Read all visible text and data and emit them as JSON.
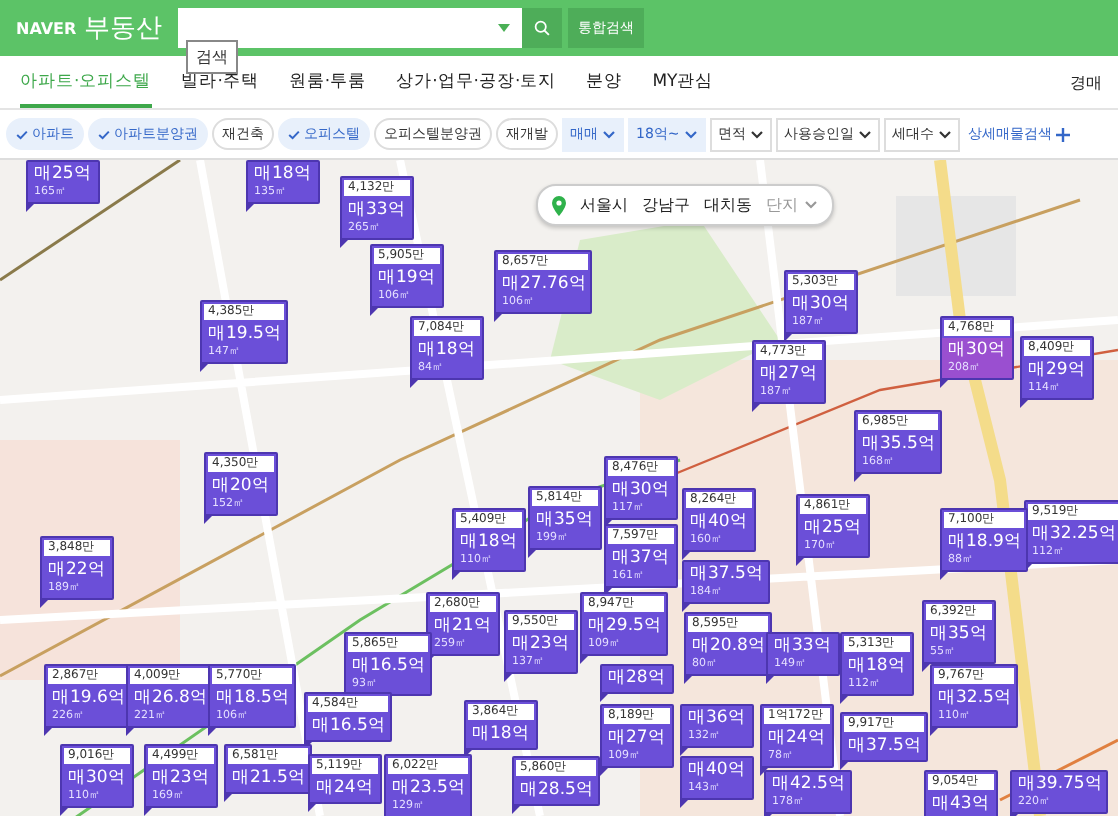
{
  "header": {
    "logo": "NAVER",
    "title": "부동산",
    "search_button_tooltip": "검색",
    "integrated_search": "통합검색"
  },
  "tabs": [
    {
      "label": "아파트·오피스텔",
      "selected": true
    },
    {
      "label": "빌라·주택",
      "selected": false
    },
    {
      "label": "원룸·투룸",
      "selected": false
    },
    {
      "label": "상가·업무·공장·토지",
      "selected": false
    },
    {
      "label": "분양",
      "selected": false
    },
    {
      "label": "MY관심",
      "selected": false
    }
  ],
  "auction_link": "경매",
  "filters": [
    {
      "kind": "chip",
      "label": "아파트",
      "checked": true
    },
    {
      "kind": "chip",
      "label": "아파트분양권",
      "checked": true
    },
    {
      "kind": "chip",
      "label": "재건축",
      "checked": false
    },
    {
      "kind": "chip",
      "label": "오피스텔",
      "checked": true
    },
    {
      "kind": "chip",
      "label": "오피스텔분양권",
      "checked": false
    },
    {
      "kind": "chip",
      "label": "재개발",
      "checked": false
    },
    {
      "kind": "dropdown",
      "label": "매매",
      "checked": true
    },
    {
      "kind": "dropdown",
      "label": "18억~",
      "checked": true
    },
    {
      "kind": "dropdown",
      "label": "면적",
      "checked": false
    },
    {
      "kind": "dropdown",
      "label": "사용승인일",
      "checked": false
    },
    {
      "kind": "dropdown",
      "label": "세대수",
      "checked": false
    }
  ],
  "detail_search": "상세매물검색",
  "breadcrumb": [
    {
      "label": "서울시",
      "disabled": false
    },
    {
      "label": "강남구",
      "disabled": false
    },
    {
      "label": "대치동",
      "disabled": false
    },
    {
      "label": "단지",
      "disabled": true
    }
  ],
  "markers": [
    {
      "price": "매25억",
      "area": "165㎡",
      "kind": "normal"
    },
    {
      "price": "매18억",
      "area": "135㎡",
      "kind": "normal"
    },
    {
      "unit_price": "4,132만",
      "price": "매33억",
      "area": "265㎡",
      "kind": "normal"
    },
    {
      "unit_price": "5,905만",
      "price": "매19억",
      "area": "106㎡",
      "kind": "normal"
    },
    {
      "unit_price": "8,657만",
      "price": "매27.76억",
      "area": "106㎡",
      "kind": "normal"
    },
    {
      "unit_price": "5,303만",
      "price": "매30억",
      "area": "187㎡",
      "kind": "normal"
    },
    {
      "unit_price": "4,385만",
      "price": "매19.5억",
      "area": "147㎡",
      "kind": "normal"
    },
    {
      "unit_price": "7,084만",
      "price": "매18억",
      "area": "84㎡",
      "kind": "normal"
    },
    {
      "unit_price": "4,768만",
      "price": "매30억",
      "area": "208㎡",
      "kind": "highlight"
    },
    {
      "unit_price": "4,773만",
      "price": "매27억",
      "area": "187㎡",
      "kind": "normal"
    },
    {
      "unit_price": "8,409만",
      "price": "매29억",
      "area": "114㎡",
      "kind": "normal"
    },
    {
      "unit_price": "6,985만",
      "price": "매35.5억",
      "area": "168㎡",
      "kind": "normal"
    },
    {
      "unit_price": "4,350만",
      "price": "매20억",
      "area": "152㎡",
      "kind": "normal"
    },
    {
      "unit_price": "8,476만",
      "price": "매30억",
      "area": "117㎡",
      "kind": "normal"
    },
    {
      "unit_price": "5,814만",
      "price": "매35억",
      "area": "199㎡",
      "kind": "normal"
    },
    {
      "unit_price": "8,264만",
      "price": "매40억",
      "area": "160㎡",
      "kind": "normal"
    },
    {
      "unit_price": "4,861만",
      "price": "매25억",
      "area": "170㎡",
      "kind": "normal"
    },
    {
      "unit_price": "9,519만",
      "price": "매32.25억",
      "area": "112㎡",
      "kind": "normal"
    },
    {
      "unit_price": "5,409만",
      "price": "매18억",
      "area": "110㎡",
      "kind": "normal"
    },
    {
      "unit_price": "7,100만",
      "price": "매18.9억",
      "area": "88㎡",
      "kind": "normal"
    },
    {
      "unit_price": "7,597만",
      "price": "매37억",
      "area": "161㎡",
      "kind": "normal"
    },
    {
      "unit_price": "3,848만",
      "price": "매22억",
      "area": "189㎡",
      "kind": "normal"
    },
    {
      "price": "매37.5억",
      "area": "184㎡",
      "kind": "normal"
    },
    {
      "unit_price": "2,680만",
      "price": "매21억",
      "area": "259㎡",
      "kind": "normal"
    },
    {
      "unit_price": "8,947만",
      "price": "매29.5억",
      "area": "109㎡",
      "kind": "normal"
    },
    {
      "unit_price": "6,392만",
      "price": "매35억",
      "area": "55㎡",
      "kind": "normal"
    },
    {
      "unit_price": "9,550만",
      "price": "매23억",
      "area": "137㎡",
      "kind": "normal"
    },
    {
      "unit_price": "8,595만",
      "price": "매20.8억",
      "area": "80㎡",
      "kind": "normal"
    },
    {
      "unit_price": "5,865만",
      "price": "매16.5억",
      "area": "93㎡",
      "kind": "normal"
    },
    {
      "price": "매33억",
      "area": "149㎡",
      "kind": "normal"
    },
    {
      "unit_price": "5,313만",
      "price": "매18억",
      "area": "112㎡",
      "kind": "normal"
    },
    {
      "unit_price": "2,867만",
      "price": "매19.6억",
      "area": "226㎡",
      "kind": "normal"
    },
    {
      "unit_price": "4,009만",
      "price": "매26.8억",
      "area": "221㎡",
      "kind": "normal"
    },
    {
      "unit_price": "5,770만",
      "price": "매18.5억",
      "area": "106㎡",
      "kind": "normal"
    },
    {
      "price": "매28억",
      "kind": "normal"
    },
    {
      "unit_price": "9,767만",
      "price": "매32.5억",
      "area": "110㎡",
      "kind": "normal"
    },
    {
      "unit_price": "4,584만",
      "price": "매16.5억",
      "kind": "normal"
    },
    {
      "unit_price": "3,864만",
      "price": "매18억",
      "kind": "normal"
    },
    {
      "unit_price": "8,189만",
      "price": "매27억",
      "area": "109㎡",
      "kind": "normal"
    },
    {
      "price": "매36억",
      "area": "132㎡",
      "kind": "normal"
    },
    {
      "unit_price": "1억172만",
      "price": "매24억",
      "area": "78㎡",
      "kind": "normal"
    },
    {
      "unit_price": "9,917만",
      "price": "매37.5억",
      "kind": "normal"
    },
    {
      "unit_price": "9,016만",
      "price": "매30억",
      "area": "110㎡",
      "kind": "normal"
    },
    {
      "unit_price": "4,499만",
      "price": "매23억",
      "area": "169㎡",
      "kind": "normal"
    },
    {
      "unit_price": "6,581만",
      "price": "매21.5억",
      "kind": "normal"
    },
    {
      "unit_price": "5,119만",
      "price": "매24억",
      "kind": "normal"
    },
    {
      "unit_price": "6,022만",
      "price": "매23.5억",
      "area": "129㎡",
      "kind": "normal"
    },
    {
      "unit_price": "5,860만",
      "price": "매28.5억",
      "kind": "normal"
    },
    {
      "price": "매40억",
      "area": "143㎡",
      "kind": "normal"
    },
    {
      "price": "매42.5억",
      "area": "178㎡",
      "kind": "normal"
    },
    {
      "unit_price": "9,054만",
      "price": "매43억",
      "kind": "normal"
    },
    {
      "price": "매39.75억",
      "area": "220㎡",
      "kind": "normal"
    }
  ]
}
